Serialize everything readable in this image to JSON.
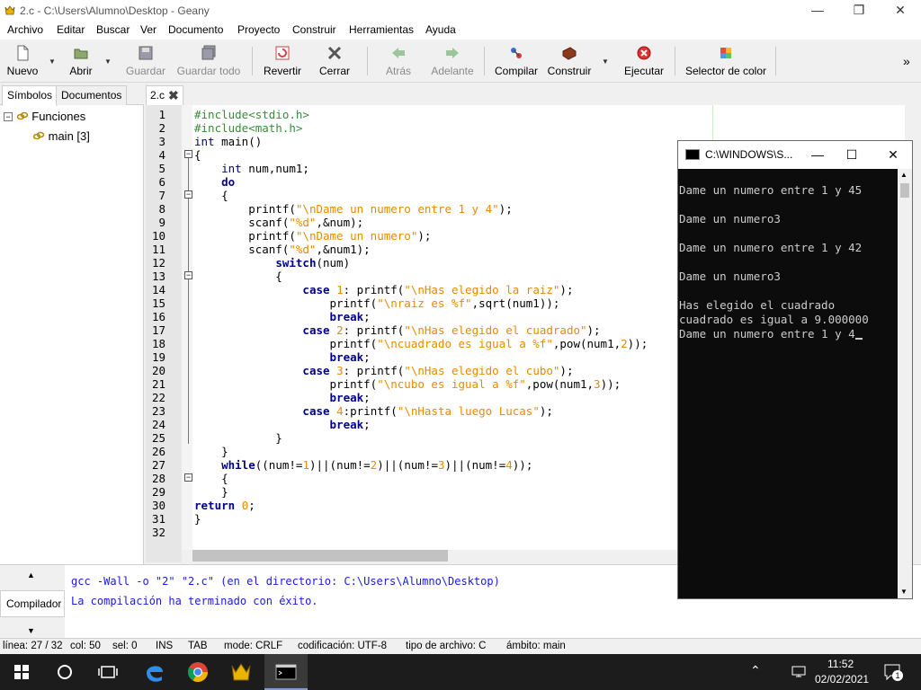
{
  "window": {
    "title": "2.c - C:\\Users\\Alumno\\Desktop - Geany"
  },
  "menu": [
    "Archivo",
    "Editar",
    "Buscar",
    "Ver",
    "Documento",
    "Proyecto",
    "Construir",
    "Herramientas",
    "Ayuda"
  ],
  "toolbar": {
    "nuevo": "Nuevo",
    "abrir": "Abrir",
    "guardar": "Guardar",
    "guardar_todo": "Guardar todo",
    "revertir": "Revertir",
    "cerrar": "Cerrar",
    "atras": "Atrás",
    "adelante": "Adelante",
    "compilar": "Compilar",
    "construir": "Construir",
    "ejecutar": "Ejecutar",
    "selector_color": "Selector de color",
    "overflow": "»"
  },
  "sidebar": {
    "tabs": [
      "Símbolos",
      "Documentos"
    ],
    "tree": {
      "group": "Funciones",
      "item": "main [3]"
    }
  },
  "editor": {
    "tab_label": "2.c",
    "line_numbers": [
      "1",
      "2",
      "3",
      "4",
      "5",
      "6",
      "7",
      "8",
      "9",
      "10",
      "11",
      "12",
      "13",
      "14",
      "15",
      "16",
      "17",
      "18",
      "19",
      "20",
      "21",
      "22",
      "23",
      "24",
      "25",
      "26",
      "27",
      "28",
      "29",
      "30",
      "31",
      "32"
    ]
  },
  "messages": {
    "tab_label": "Compilador",
    "lines": [
      "gcc -Wall -o \"2\" \"2.c\" (en el directorio: C:\\Users\\Alumno\\Desktop)",
      "La compilación ha terminado con éxito."
    ]
  },
  "statusbar": {
    "line": "línea: 27 / 32",
    "col": "col: 50",
    "sel": "sel: 0",
    "ins": "INS",
    "tab": "TAB",
    "mode": "mode: CRLF",
    "encoding": "codificación: UTF-8",
    "filetype": "tipo de archivo: C",
    "scope": "ámbito: main"
  },
  "console": {
    "title": "C:\\WINDOWS\\S...",
    "lines": [
      "",
      "Dame un numero entre 1 y 45",
      "",
      "Dame un numero3",
      "",
      "Dame un numero entre 1 y 42",
      "",
      "Dame un numero3",
      "",
      "Has elegido el cuadrado",
      "cuadrado es igual a 9.000000",
      "Dame un numero entre 1 y 4"
    ]
  },
  "taskbar": {
    "time": "11:52",
    "date": "02/02/2021",
    "notifications": "1"
  },
  "colors": {
    "keyword": "#00008b",
    "string": "#e68a00",
    "preprocessor": "#3a8c3a",
    "message": "#1a1ae0",
    "console_text": "#cccccc"
  }
}
